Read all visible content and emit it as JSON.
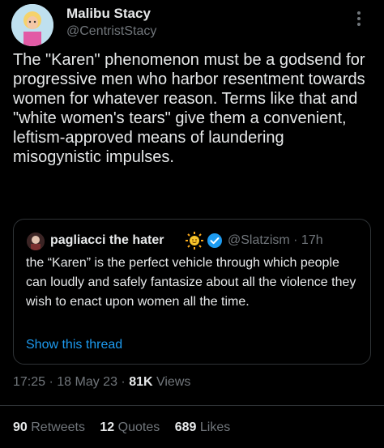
{
  "author": {
    "name": "Malibu Stacy",
    "handle": "@CentristStacy",
    "avatar_icon": "avatar-illustration-icon"
  },
  "tweet": {
    "text": "The \"Karen\" phenomenon must be a godsend for progressive men who harbor resentment towards women for whatever reason. Terms like that and \"white women's tears\" give them a convenient, leftism-approved means of laundering misogynistic impulses."
  },
  "quote": {
    "name": "pagliacci the hater",
    "handle_time": "@Slatzism · 17h",
    "text": "the “Karen” is the perfect vehicle through which people can loudly and safely fantasize about all the violence they wish to enact upon women all the time.",
    "show_thread": "Show this thread"
  },
  "meta": {
    "time_date": "17:25 · 18 May 23 · ",
    "views_count": "81K",
    "views_label": " Views"
  },
  "stats": {
    "retweets_count": "90",
    "retweets_label": "Retweets",
    "quotes_count": "12",
    "quotes_label": "Quotes",
    "likes_count": "689",
    "likes_label": "Likes"
  },
  "colors": {
    "background": "#000000",
    "text": "#e7e9ea",
    "muted": "#71767b",
    "link": "#1d9bf0",
    "border": "#2f3336"
  }
}
